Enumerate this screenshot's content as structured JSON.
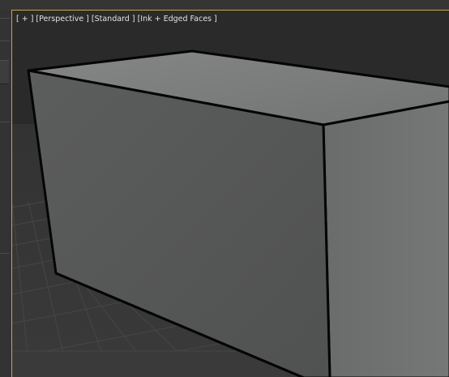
{
  "viewport": {
    "label": "[ + ] [Perspective ] [Standard ] [Ink + Edged Faces ]",
    "view_name": "Perspective",
    "shading_mode": "Ink + Edged Faces",
    "active_border_color": "#c9a73f"
  },
  "scene": {
    "object": "box",
    "face_top_color": "#7a7b7b",
    "face_front_color": "#555656",
    "face_side_color": "#6d6e6e",
    "edge_color": "#050505",
    "grid_color": "#4a4a4a",
    "background_color": "#2e2e2e"
  }
}
